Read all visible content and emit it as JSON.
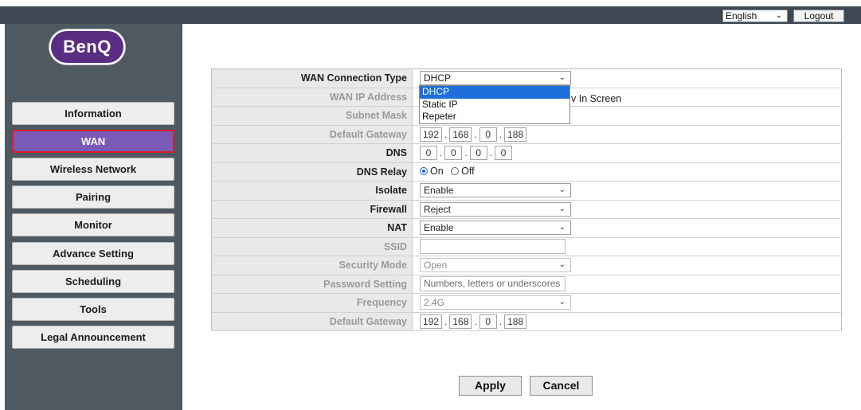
{
  "topbar": {
    "language": "English",
    "logout_label": "Logout"
  },
  "brand": {
    "logo_text": "BenQ"
  },
  "sidebar": {
    "items": [
      {
        "label": "Information",
        "active": false
      },
      {
        "label": "WAN",
        "active": true
      },
      {
        "label": "Wireless Network",
        "active": false
      },
      {
        "label": "Pairing",
        "active": false
      },
      {
        "label": "Monitor",
        "active": false
      },
      {
        "label": "Advance Setting",
        "active": false
      },
      {
        "label": "Scheduling",
        "active": false
      },
      {
        "label": "Tools",
        "active": false
      },
      {
        "label": "Legal Announcement",
        "active": false
      }
    ]
  },
  "form": {
    "wan_connection_type": {
      "label": "WAN Connection Type",
      "value": "DHCP"
    },
    "wan_ip_address": {
      "label": "WAN IP Address",
      "partial_text": "v In Screen"
    },
    "subnet_mask": {
      "label": "Subnet Mask"
    },
    "default_gateway": {
      "label": "Default Gateway",
      "octets": [
        "192",
        "168",
        "0",
        "188"
      ]
    },
    "dns": {
      "label": "DNS",
      "octets": [
        "0",
        "0",
        "0",
        "0"
      ]
    },
    "dns_relay": {
      "label": "DNS Relay",
      "on_label": "On",
      "off_label": "Off",
      "selected": "On"
    },
    "isolate": {
      "label": "Isolate",
      "value": "Enable"
    },
    "firewall": {
      "label": "Firewall",
      "value": "Reject"
    },
    "nat": {
      "label": "NAT",
      "value": "Enable"
    },
    "ssid": {
      "label": "SSID",
      "value": ""
    },
    "security_mode": {
      "label": "Security Mode",
      "value": "Open"
    },
    "password_setting": {
      "label": "Password Setting",
      "placeholder": "Numbers, letters or underscores"
    },
    "frequency": {
      "label": "Frequency",
      "value": "2.4G"
    },
    "default_gateway_2": {
      "label": "Default Gateway",
      "octets": [
        "192",
        "168",
        "0",
        "188"
      ]
    }
  },
  "dropdown": {
    "options": [
      {
        "label": "DHCP",
        "highlighted": true
      },
      {
        "label": "Static IP",
        "highlighted": false
      },
      {
        "label": "Repeter",
        "highlighted": false
      }
    ]
  },
  "actions": {
    "apply_label": "Apply",
    "cancel_label": "Cancel"
  },
  "colors": {
    "topbar_bg": "#3d4852",
    "sidebar_bg": "#4f5962",
    "active_nav_bg": "#7b59b6",
    "active_nav_border": "#d6202a",
    "dropdown_highlight": "#1e6fd9",
    "logo_bg": "#5a2c82"
  }
}
